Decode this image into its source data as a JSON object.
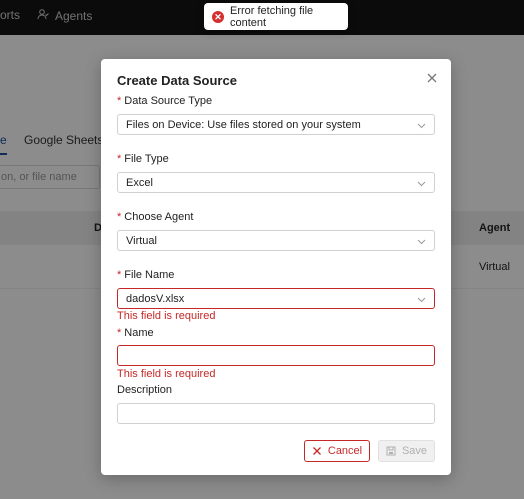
{
  "nav": {
    "reports_label": "orts",
    "agents_label": "Agents"
  },
  "background": {
    "tab_active_label": "e",
    "tab_sheets_label": "Google Sheets",
    "search_placeholder": "on, or file name",
    "col_d_label": "D",
    "col_agent_label": "Agent",
    "row_agent_value": "Virtual"
  },
  "toast": {
    "message": "Error fetching file content",
    "icon": "error-circle-icon",
    "color": "#d32f2f"
  },
  "modal": {
    "title": "Create Data Source",
    "fields": {
      "data_source_type": {
        "label": "Data Source Type",
        "value": "Files on Device: Use files stored on your system"
      },
      "file_type": {
        "label": "File Type",
        "value": "Excel"
      },
      "agent": {
        "label": "Choose Agent",
        "value": "Virtual"
      },
      "file_name": {
        "label": "File Name",
        "value": "dadosV.xlsx",
        "error": "This field is required"
      },
      "name": {
        "label": "Name",
        "value": "",
        "error": "This field is required"
      },
      "description": {
        "label": "Description",
        "value": ""
      }
    },
    "required_marker": "*",
    "buttons": {
      "cancel": "Cancel",
      "save": "Save"
    }
  },
  "colors": {
    "error": "#c62828",
    "topbar": "#151515"
  }
}
